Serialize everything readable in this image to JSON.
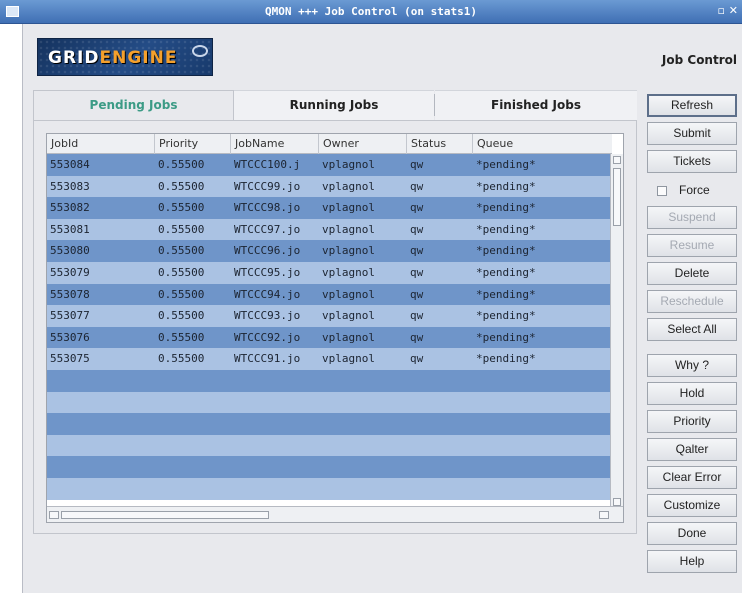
{
  "window": {
    "title": "QMON +++ Job Control (on stats1)"
  },
  "header": {
    "logo_text_a": "GRID",
    "logo_text_b": "ENGINE",
    "title": "Job Control"
  },
  "tabs": [
    {
      "label": "Pending Jobs",
      "active": true
    },
    {
      "label": "Running Jobs",
      "active": false
    },
    {
      "label": "Finished Jobs",
      "active": false
    }
  ],
  "table": {
    "columns": [
      "JobId",
      "Priority",
      "JobName",
      "Owner",
      "Status",
      "Queue"
    ],
    "rows": [
      [
        "553084",
        "0.55500",
        "WTCCC100.j",
        "vplagnol",
        "qw",
        "*pending*"
      ],
      [
        "553083",
        "0.55500",
        "WTCCC99.jo",
        "vplagnol",
        "qw",
        "*pending*"
      ],
      [
        "553082",
        "0.55500",
        "WTCCC98.jo",
        "vplagnol",
        "qw",
        "*pending*"
      ],
      [
        "553081",
        "0.55500",
        "WTCCC97.jo",
        "vplagnol",
        "qw",
        "*pending*"
      ],
      [
        "553080",
        "0.55500",
        "WTCCC96.jo",
        "vplagnol",
        "qw",
        "*pending*"
      ],
      [
        "553079",
        "0.55500",
        "WTCCC95.jo",
        "vplagnol",
        "qw",
        "*pending*"
      ],
      [
        "553078",
        "0.55500",
        "WTCCC94.jo",
        "vplagnol",
        "qw",
        "*pending*"
      ],
      [
        "553077",
        "0.55500",
        "WTCCC93.jo",
        "vplagnol",
        "qw",
        "*pending*"
      ],
      [
        "553076",
        "0.55500",
        "WTCCC92.jo",
        "vplagnol",
        "qw",
        "*pending*"
      ],
      [
        "553075",
        "0.55500",
        "WTCCC91.jo",
        "vplagnol",
        "qw",
        "*pending*"
      ]
    ],
    "empty_rows": 6
  },
  "buttons": {
    "refresh": "Refresh",
    "submit": "Submit",
    "tickets": "Tickets",
    "force": "Force",
    "suspend": "Suspend",
    "resume": "Resume",
    "delete": "Delete",
    "reschedule": "Reschedule",
    "select_all": "Select All",
    "why": "Why ?",
    "hold": "Hold",
    "priority": "Priority",
    "qalter": "Qalter",
    "clear_error": "Clear Error",
    "customize": "Customize",
    "done": "Done",
    "help": "Help"
  },
  "colors": {
    "row_dark": "#6f95c9",
    "row_light": "#aac2e3",
    "active_tab_text": "#3c9b86",
    "titlebar": "#4f80c2"
  }
}
